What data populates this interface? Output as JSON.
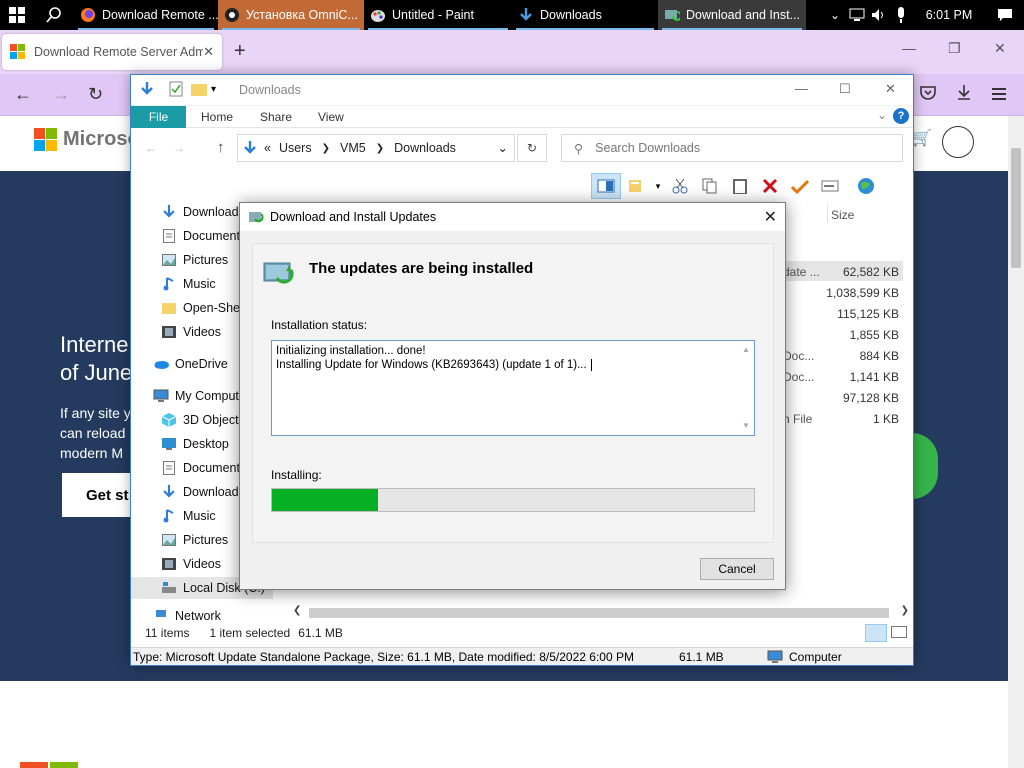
{
  "taskbar": {
    "tasks": [
      {
        "label": "Download Remote ...",
        "icon": "firefox-icon"
      },
      {
        "label": "Установка OmniC...",
        "icon": "app-icon"
      },
      {
        "label": "Untitled - Paint",
        "icon": "paint-icon"
      },
      {
        "label": "Downloads",
        "icon": "downloads-icon"
      },
      {
        "label": "Download and Inst...",
        "icon": "windows-update-icon"
      }
    ],
    "clock": "6:01 PM"
  },
  "browser": {
    "tab_title": "Download Remote Server Admi",
    "page": {
      "logo_text": "Microso",
      "hero_title_line1": "Interne",
      "hero_title_line2": "of June",
      "hero_text_line1": "If any site y",
      "hero_text_line2": "can reload",
      "hero_text_line3": "modern M",
      "hero_button": "Get st"
    }
  },
  "explorer": {
    "title": "Downloads",
    "ribbon_tabs": [
      "File",
      "Home",
      "Share",
      "View"
    ],
    "address": {
      "prefix": "«",
      "parts": [
        "Users",
        "VM5",
        "Downloads"
      ]
    },
    "search_placeholder": "Search Downloads",
    "column_size": "Size",
    "nav_items": [
      "Downloads",
      "Documents",
      "Pictures",
      "Music",
      "Open-Shel",
      "Videos",
      "OneDrive",
      "My Comput",
      "3D Objects",
      "Desktop",
      "Documents",
      "Downloads",
      "Music",
      "Pictures",
      "Videos",
      "Local Disk (C:)",
      "Network"
    ],
    "rows": [
      {
        "type": "date ...",
        "size": "62,582 KB"
      },
      {
        "type": "",
        "size": "1,038,599 KB"
      },
      {
        "type": "",
        "size": "115,125 KB"
      },
      {
        "type": "",
        "size": "1,855 KB"
      },
      {
        "type": "Doc...",
        "size": "884 KB"
      },
      {
        "type": "Doc...",
        "size": "1,141 KB"
      },
      {
        "type": "",
        "size": "97,128 KB"
      },
      {
        "type": "h File",
        "size": "1 KB"
      }
    ],
    "status": {
      "items": "11 items",
      "selected": "1 item selected",
      "size": "61.1 MB"
    },
    "details": {
      "text": "Type: Microsoft Update Standalone Package, Size: 61.1 MB, Date modified: 8/5/2022 6:00 PM",
      "size": "61.1 MB",
      "location": "Computer"
    }
  },
  "dialog": {
    "title": "Download and Install Updates",
    "heading": "The updates are being installed",
    "status_label": "Installation status:",
    "status_lines": [
      "Initializing installation... done!",
      "Installing Update for Windows (KB2693643) (update 1 of 1)..."
    ],
    "progress_label": "Installing:",
    "progress_fraction": 0.22,
    "cancel_label": "Cancel"
  },
  "colors": {
    "accent": "#1b9ba6",
    "progress": "#06b025",
    "hero_bg": "#243a5e"
  }
}
